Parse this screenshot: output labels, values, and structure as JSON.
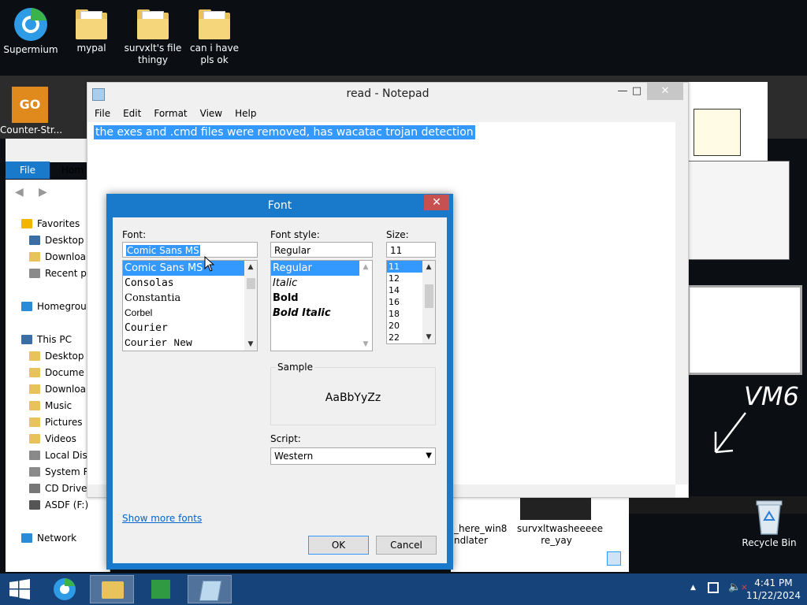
{
  "desktop": {
    "icons": [
      {
        "label": "Supermium"
      },
      {
        "label": "mypal"
      },
      {
        "label": "survxlt's file thingy"
      },
      {
        "label": "can i have pls ok"
      },
      {
        "label": "Counter-Str..."
      }
    ],
    "recycle_bin": "Recycle Bin",
    "drawing_text": "VM6",
    "thumb_caption_1": "_here_win8 ndlater",
    "thumb_caption_2": "survxltwasheeeee re_yay"
  },
  "explorer": {
    "file_tab": "File",
    "home_tab": "Hom",
    "nav_items": [
      {
        "label": "Favorites",
        "icon": "star-icon",
        "color": "#f2b600"
      },
      {
        "label": "Desktop",
        "icon": "desktop-icon",
        "color": "#3a6ea5"
      },
      {
        "label": "Downloa",
        "icon": "folder-icon",
        "color": "#e8c25a"
      },
      {
        "label": "Recent p",
        "icon": "recent-icon",
        "color": "#8a8a8a"
      },
      {
        "label": "Homegrou",
        "icon": "homegroup-icon",
        "color": "#2a8bd6"
      },
      {
        "label": "This PC",
        "icon": "computer-icon",
        "color": "#3a6ea5"
      },
      {
        "label": "Desktop",
        "icon": "folder-icon",
        "color": "#e8c25a"
      },
      {
        "label": "Docume",
        "icon": "folder-icon",
        "color": "#e8c25a"
      },
      {
        "label": "Downloa",
        "icon": "folder-icon",
        "color": "#e8c25a"
      },
      {
        "label": "Music",
        "icon": "folder-icon",
        "color": "#e8c25a"
      },
      {
        "label": "Pictures",
        "icon": "folder-icon",
        "color": "#e8c25a"
      },
      {
        "label": "Videos",
        "icon": "folder-icon",
        "color": "#e8c25a"
      },
      {
        "label": "Local Dis",
        "icon": "drive-icon",
        "color": "#8a8a8a"
      },
      {
        "label": "System R",
        "icon": "drive-icon",
        "color": "#8a8a8a"
      },
      {
        "label": "CD Drive",
        "icon": "cd-drive-icon",
        "color": "#777777"
      },
      {
        "label": "ASDF (F:)",
        "icon": "usb-drive-icon",
        "color": "#555555"
      },
      {
        "label": "Network",
        "icon": "network-icon",
        "color": "#2a8bd6"
      }
    ]
  },
  "notepad": {
    "title": "read - Notepad",
    "menu": [
      "File",
      "Edit",
      "Format",
      "View",
      "Help"
    ],
    "content": "the exes and .cmd files were removed, has wacatac trojan detection"
  },
  "font_dialog": {
    "title": "Font",
    "font_label": "Font:",
    "font_value": "Comic Sans MS",
    "fonts": [
      "Comic Sans MS",
      "Consolas",
      "Constantia",
      "Corbel",
      "Courier",
      "Courier New"
    ],
    "style_label": "Font style:",
    "style_value": "Regular",
    "styles": [
      "Regular",
      "Italic",
      "Bold",
      "Bold Italic"
    ],
    "size_label": "Size:",
    "size_value": "11",
    "sizes": [
      "11",
      "12",
      "14",
      "16",
      "18",
      "20",
      "22"
    ],
    "sample_label": "Sample",
    "sample_text": "AaBbYyZz",
    "script_label": "Script:",
    "script_value": "Western",
    "show_more": "Show more fonts",
    "ok": "OK",
    "cancel": "Cancel"
  },
  "taskbar": {
    "time": "4:41 PM",
    "date": "11/22/2024"
  },
  "colors": {
    "accent": "#1979ca",
    "selection": "#3399ff",
    "taskbar": "#16437a"
  }
}
